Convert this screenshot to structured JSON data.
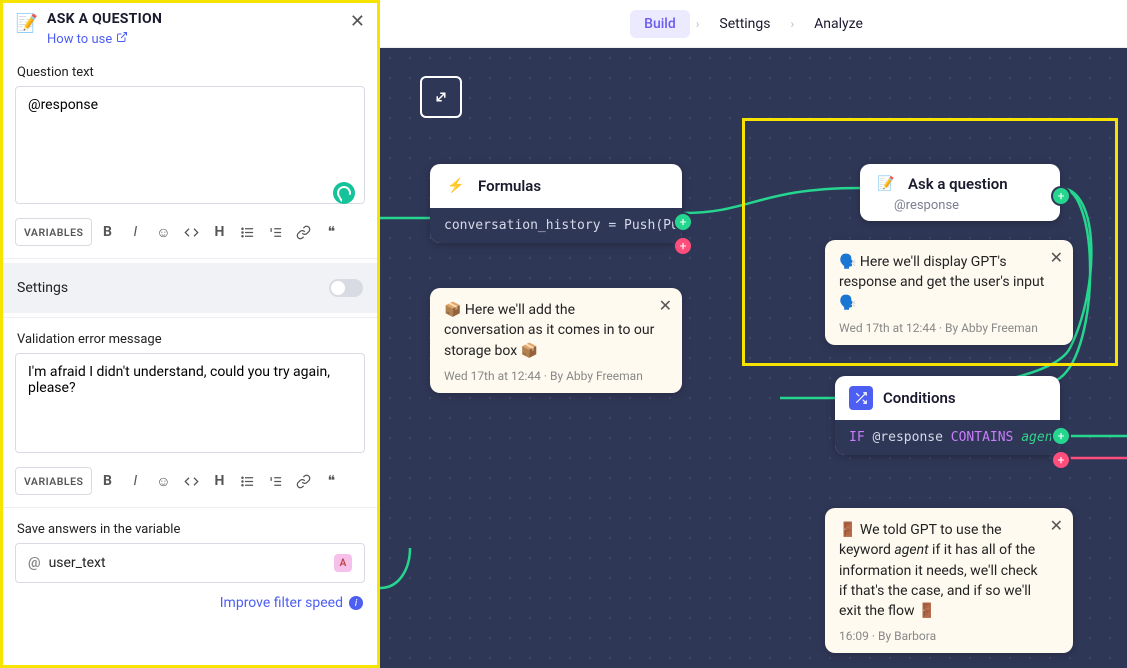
{
  "topnav": {
    "tabs": [
      "Build",
      "Settings",
      "Analyze"
    ],
    "active": 0
  },
  "panel": {
    "title": "ASK A QUESTION",
    "howto": "How to use",
    "question_label": "Question text",
    "question_value": "@response",
    "toolbar_variables": "VARIABLES",
    "settings_label": "Settings",
    "validation_label": "Validation error message",
    "validation_value": "I'm afraid I didn't understand, could you try again, please?",
    "save_label": "Save answers in the variable",
    "save_variable": "user_text",
    "save_badge": "A",
    "improve": "Improve filter speed"
  },
  "canvas": {
    "formulas": {
      "title": "Formulas",
      "code": "conversation_history = Push(Pus"
    },
    "ask": {
      "title": "Ask a question",
      "sub": "@response"
    },
    "conditions": {
      "title": "Conditions",
      "if": "IF",
      "var": "@response",
      "contains": "CONTAINS",
      "val": "agent"
    },
    "comment_storage": {
      "text": "📦 Here we'll add the conversation as it comes in to our storage box 📦",
      "meta": "Wed 17th at 12:44 · By Abby Freeman"
    },
    "comment_gpt": {
      "text": "🗣️ Here we'll display GPT's response and get the user's input 🗣️",
      "meta": "Wed 17th at 12:44 · By Abby Freeman"
    },
    "comment_agent": {
      "text_prefix": "🚪 We told GPT to use the keyword ",
      "text_italic": "agent",
      "text_suffix": " if it has all of the information it needs, we'll check if that's the case, and if so we'll exit the flow 🚪",
      "meta": "16:09 · By Barbora"
    }
  }
}
